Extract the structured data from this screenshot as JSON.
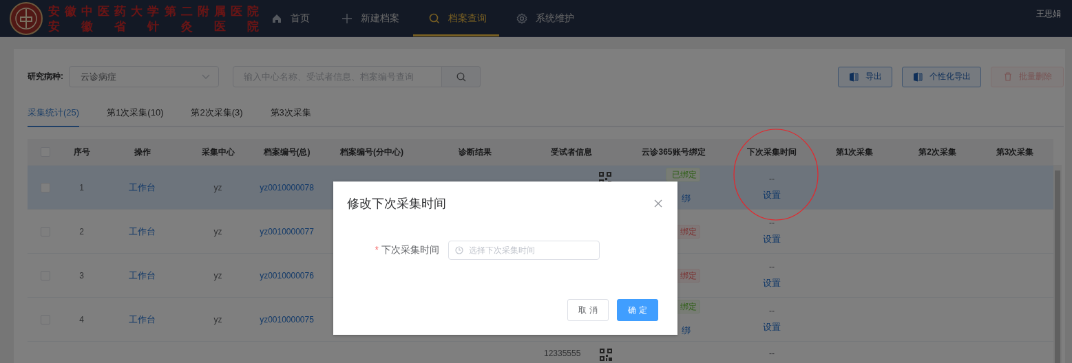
{
  "header": {
    "logo_lines": [
      "安徽中医药大学第二附属医院",
      "安徽省针灸医院"
    ],
    "nav": [
      {
        "label": "首页",
        "selected": false
      },
      {
        "label": "新建档案",
        "selected": false
      },
      {
        "label": "档案查询",
        "selected": true
      },
      {
        "label": "系统维护",
        "selected": false
      }
    ],
    "user": "王思娟"
  },
  "filters": {
    "label": "研究病种:",
    "select_value": "云诊病症",
    "search_placeholder": "输入中心名称、受试者信息、档案编号查询"
  },
  "actions": [
    {
      "label": "导出",
      "kind": "export",
      "disabled": false
    },
    {
      "label": "个性化导出",
      "kind": "export",
      "disabled": false
    },
    {
      "label": "批量删除",
      "kind": "delete",
      "disabled": true
    }
  ],
  "tabs": [
    {
      "label": "采集统计(25)",
      "selected": true
    },
    {
      "label": "第1次采集(10)",
      "selected": false
    },
    {
      "label": "第2次采集(3)",
      "selected": false
    },
    {
      "label": "第3次采集",
      "selected": false
    }
  ],
  "table": {
    "header_checked": false,
    "columns": [
      "序号",
      "操作",
      "采集中心",
      "档案编号(总)",
      "档案编号(分中心)",
      "诊断结果",
      "受试者信息",
      "云诊365账号绑定",
      "下次采集时间",
      "第1次采集",
      "第2次采集",
      "第3次采集"
    ],
    "rows": [
      {
        "selected": true,
        "checked": false,
        "index": "1",
        "action": "工作台",
        "center": "yz",
        "archive_no": "yz0010000078",
        "qr_code": true,
        "binding": {
          "text": "已绑定",
          "kind": "bound"
        },
        "unbind": "绑",
        "next_time": "--",
        "set": "设置"
      },
      {
        "selected": false,
        "checked": false,
        "index": "2",
        "action": "工作台",
        "center": "yz",
        "archive_no": "yz0010000077",
        "binding": {
          "text": "绑定",
          "kind": "unbound"
        },
        "next_time": "--",
        "set": "设置"
      },
      {
        "selected": false,
        "checked": false,
        "index": "3",
        "action": "工作台",
        "center": "yz",
        "archive_no": "yz0010000076",
        "binding": {
          "text": "绑定",
          "kind": "unbound"
        },
        "next_time": "--",
        "set": "设置"
      },
      {
        "selected": false,
        "checked": false,
        "index": "4",
        "action": "工作台",
        "center": "yz",
        "archive_no": "yz0010000075",
        "binding": {
          "text": "绑定",
          "kind": "bound"
        },
        "unbind": "绑",
        "next_time": "--",
        "set": "设置"
      },
      {
        "selected": false,
        "subject": "12335555",
        "qr_code": true,
        "next_time": "--"
      }
    ]
  },
  "dialog": {
    "title": "修改下次采集时间",
    "field": {
      "required_mark": "*",
      "label": "下次采集时间",
      "placeholder": "选择下次采集时间"
    },
    "buttons": [
      {
        "label": "取 消",
        "kind": "default"
      },
      {
        "label": "确 定",
        "kind": "primary"
      }
    ]
  }
}
